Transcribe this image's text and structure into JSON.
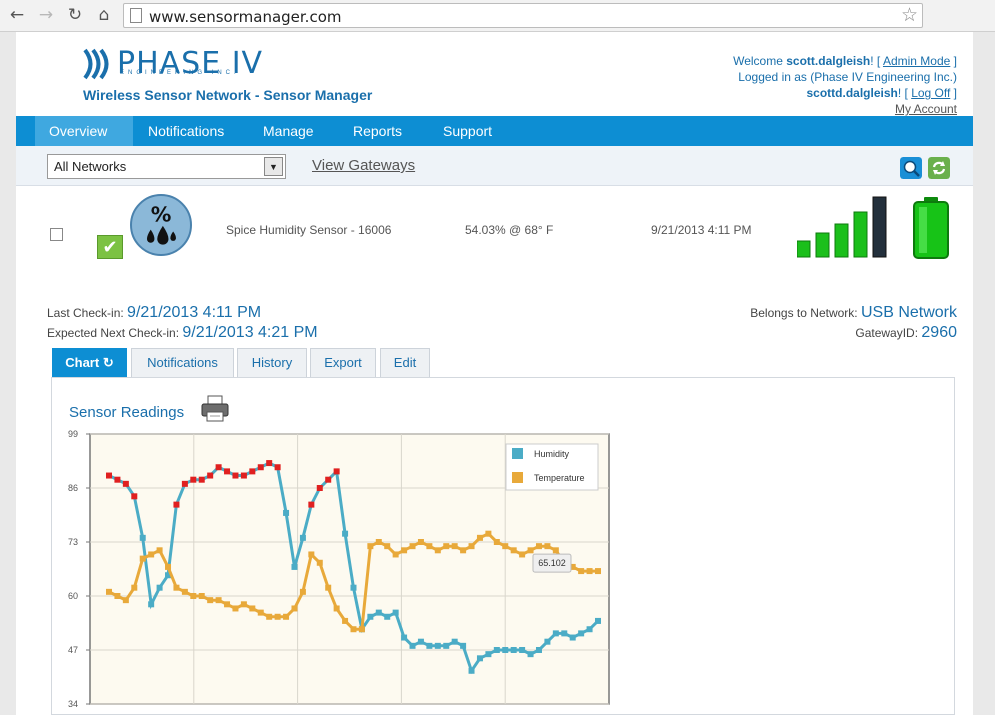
{
  "browser": {
    "url": "www.sensormanager.com",
    "icons": [
      "back-arrow-icon",
      "forward-arrow-icon",
      "reload-icon",
      "home-icon",
      "bookmark-star-icon"
    ]
  },
  "brand": {
    "name": "PHASE IV",
    "sub": "ENGINEERING INC.",
    "app_title": "Wireless Sensor Network - Sensor Manager",
    "color": "#1a6fab"
  },
  "user": {
    "welcome": "Welcome ",
    "username": "scott.dalgleish",
    "admin_mode": "Admin Mode",
    "logged_in_as": "Logged in as (Phase IV Engineering Inc.)",
    "login_name": "scottd.dalgleish",
    "log_off": "Log Off",
    "my_account": "My Account"
  },
  "menu": [
    "Overview",
    "Notifications",
    "Manage",
    "Reports",
    "Support"
  ],
  "filter": {
    "network_select": "All Networks",
    "view_gateways": "View Gateways"
  },
  "sensor": {
    "name": "Spice Humidity Sensor - 16006",
    "reading": "54.03% @ 68° F",
    "timestamp": "9/21/2013 4:11 PM",
    "icon": "humidity-percent-icon"
  },
  "details": {
    "last_checkin_label": "Last Check-in:",
    "last_checkin": "9/21/2013 4:11 PM",
    "next_checkin_label": "Expected Next Check-in:",
    "next_checkin": "9/21/2013 4:21 PM",
    "network_label": "Belongs to Network:",
    "network": "USB Network",
    "gateway_label": "GatewayID:",
    "gateway": "2960"
  },
  "tabs": [
    "Chart",
    "Notifications",
    "History",
    "Export",
    "Edit"
  ],
  "chart_title": "Sensor Readings",
  "chart_data": {
    "type": "line",
    "y_ticks": [
      99,
      86,
      73,
      60,
      47,
      34
    ],
    "ylim": [
      34,
      99
    ],
    "legend": [
      "Humidity",
      "Temperature"
    ],
    "tooltip": "65.102",
    "colors": {
      "humidity": "#4bacc6",
      "temperature": "#e8a93a",
      "alarm": "#e02020"
    },
    "series": [
      {
        "name": "Humidity",
        "values": [
          89,
          88,
          87,
          84,
          74,
          58,
          62,
          65,
          82,
          87,
          88,
          88,
          89,
          91,
          90,
          89,
          89,
          90,
          91,
          92,
          91,
          80,
          67,
          74,
          82,
          86,
          88,
          90,
          75,
          62,
          52,
          55,
          56,
          55,
          56,
          50,
          48,
          49,
          48,
          48,
          48,
          49,
          48,
          42,
          45,
          46,
          47,
          47,
          47,
          47,
          46,
          47,
          49,
          51,
          51,
          50,
          51,
          52,
          54
        ]
      },
      {
        "name": "Temperature",
        "values": [
          61,
          60,
          59,
          62,
          69,
          70,
          71,
          67,
          62,
          61,
          60,
          60,
          59,
          59,
          58,
          57,
          58,
          57,
          56,
          55,
          55,
          55,
          57,
          61,
          70,
          68,
          62,
          57,
          54,
          52,
          52,
          72,
          73,
          72,
          70,
          71,
          72,
          73,
          72,
          71,
          72,
          72,
          71,
          72,
          74,
          75,
          73,
          72,
          71,
          70,
          71,
          72,
          72,
          71,
          68,
          67,
          66,
          66,
          66
        ]
      }
    ],
    "humidity_alarm_indices": [
      0,
      1,
      2,
      3,
      8,
      9,
      10,
      11,
      12,
      13,
      14,
      15,
      16,
      17,
      18,
      19,
      20,
      24,
      25,
      26,
      27
    ]
  }
}
